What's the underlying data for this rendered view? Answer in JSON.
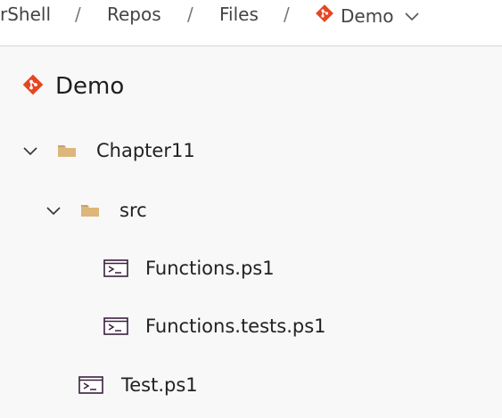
{
  "breadcrumb": {
    "items": [
      {
        "label": "rShell"
      },
      {
        "label": "Repos"
      },
      {
        "label": "Files"
      },
      {
        "label": "Demo"
      }
    ],
    "separator": "/"
  },
  "repo": {
    "title": "Demo"
  },
  "tree": {
    "chapter": {
      "label": "Chapter11",
      "expanded": true
    },
    "src": {
      "label": "src",
      "expanded": true
    },
    "file1": {
      "label": "Functions.ps1"
    },
    "file2": {
      "label": "Functions.tests.ps1"
    },
    "file3": {
      "label": "Test.ps1"
    }
  },
  "colors": {
    "git_brand": "#e8451f",
    "folder": "#dcb67a",
    "ps_icon": "#3b1f3f"
  },
  "icons": {
    "git": "git-icon",
    "folder": "folder-icon",
    "chevron": "chevron-down-icon",
    "powershell": "powershell-file-icon"
  }
}
